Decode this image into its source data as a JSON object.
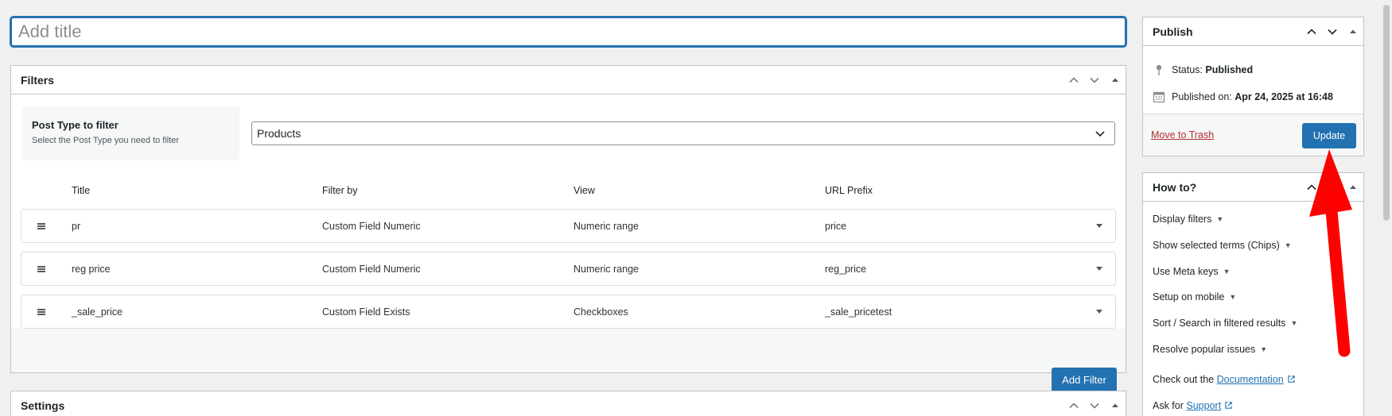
{
  "title_field": {
    "placeholder": "Add title",
    "value": ""
  },
  "filters": {
    "heading": "Filters",
    "post_type": {
      "label": "Post Type to filter",
      "description": "Select the Post Type you need to filter",
      "selected": "Products"
    },
    "columns": [
      "Title",
      "Filter by",
      "View",
      "URL Prefix"
    ],
    "rows": [
      {
        "title": "pr",
        "filter_by": "Custom Field Numeric",
        "view": "Numeric range",
        "url_prefix": "price"
      },
      {
        "title": "reg price",
        "filter_by": "Custom Field Numeric",
        "view": "Numeric range",
        "url_prefix": "reg_price"
      },
      {
        "title": "_sale_price",
        "filter_by": "Custom Field Exists",
        "view": "Checkboxes",
        "url_prefix": "_sale_pricetest"
      }
    ],
    "add_button": "Add Filter"
  },
  "settings": {
    "heading": "Settings"
  },
  "publish": {
    "heading": "Publish",
    "status_label": "Status:",
    "status_value": "Published",
    "published_label": "Published on:",
    "published_value": "Apr 24, 2025 at 16:48",
    "trash_link": "Move to Trash",
    "update_button": "Update"
  },
  "howto": {
    "heading": "How to?",
    "items": [
      "Display filters",
      "Show selected terms (Chips)",
      "Use Meta keys",
      "Setup on mobile",
      "Sort / Search in filtered results",
      "Resolve popular issues"
    ],
    "docs_prefix": "Check out the",
    "docs_link": "Documentation",
    "support_prefix": "Ask for",
    "support_link": "Support"
  },
  "colors": {
    "accent": "#2271b1",
    "annotation": "#ff0000",
    "danger": "#b32d2e"
  }
}
